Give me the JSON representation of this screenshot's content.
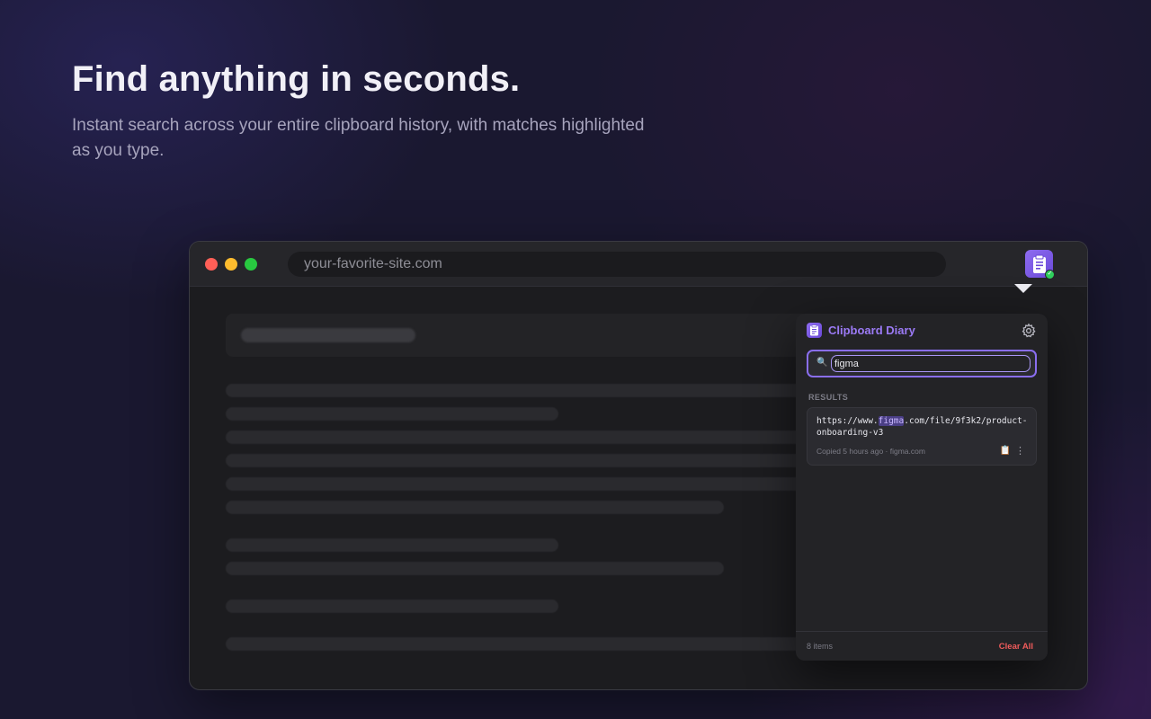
{
  "hero": {
    "title": "Find anything in seconds.",
    "subtitle": "Instant search across your entire clipboard history, with matches highlighted as you type."
  },
  "browser": {
    "url": "your-favorite-site.com",
    "extension_icon": "clipboard-icon"
  },
  "popup": {
    "app_name": "Clipboard Diary",
    "settings_icon": "gear-icon",
    "search": {
      "icon": "magnifier-icon",
      "value": "figma"
    },
    "section_label": "RESULTS",
    "results": [
      {
        "text_before": "https://www.",
        "match": "figma",
        "text_after": ".com/file/9f3k2/product-onboarding-v3",
        "meta": "Copied 5 hours ago · figma.com",
        "copy_icon": "clipboard-copy-icon",
        "more_icon": "more-vertical-icon"
      }
    ],
    "footer": {
      "count": "8 items",
      "clear_label": "Clear All"
    }
  },
  "colors": {
    "accent": "#8a6ef0",
    "danger": "#f05b5b",
    "background": "#1a1830"
  }
}
